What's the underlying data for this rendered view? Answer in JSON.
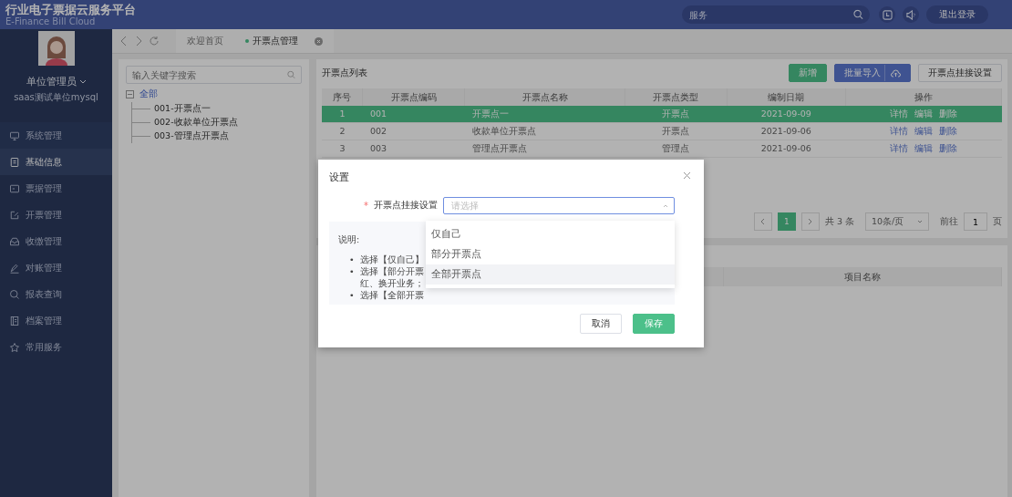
{
  "header": {
    "title": "行业电子票据云服务平台",
    "subtitle": "E-Finance Bill Cloud",
    "search": {
      "placeholder": "服务"
    },
    "logout": "退出登录"
  },
  "sidebar": {
    "user": "单位管理员",
    "org": "saas测试单位mysql",
    "items": [
      {
        "label": "系统管理",
        "kind": "monitor",
        "selected": false
      },
      {
        "label": "基础信息",
        "kind": "doc",
        "selected": true
      },
      {
        "label": "票据管理",
        "kind": "card",
        "selected": false
      },
      {
        "label": "开票管理",
        "kind": "edit",
        "selected": false
      },
      {
        "label": "收缴管理",
        "kind": "inbox",
        "selected": false
      },
      {
        "label": "对账管理",
        "kind": "pen",
        "selected": false
      },
      {
        "label": "报表查询",
        "kind": "search",
        "selected": false
      },
      {
        "label": "档案管理",
        "kind": "book",
        "selected": false
      },
      {
        "label": "常用服务",
        "kind": "star",
        "selected": false
      }
    ]
  },
  "tabs": [
    {
      "label": "欢迎首页",
      "selected": false
    },
    {
      "label": "开票点管理",
      "selected": true
    }
  ],
  "tree": {
    "search": {
      "placeholder": "输入关键字搜索"
    },
    "nodes": [
      {
        "label": "全部",
        "expanded": true,
        "selected": true,
        "children": [
          {
            "label": "001-开票点一",
            "selected": false
          },
          {
            "label": "002-收款单位开票点",
            "selected": false
          },
          {
            "label": "003-管理点开票点",
            "selected": false
          }
        ]
      }
    ]
  },
  "list": {
    "title": "开票点列表",
    "buttons": [
      {
        "label": "新增",
        "kind": "add"
      },
      {
        "label": "批量导入",
        "kind": "import"
      },
      {
        "label": "开票点挂接设置",
        "kind": "plain"
      }
    ],
    "columns": [
      "序号",
      "开票点编码",
      "开票点名称",
      "开票点类型",
      "编制日期",
      "操作"
    ],
    "rows": [
      {
        "cells": [
          "1",
          "001",
          "开票点一",
          "开票点",
          "2021-09-09"
        ],
        "actions": [
          "详情",
          "编辑",
          "删除"
        ],
        "selected": true
      },
      {
        "cells": [
          "2",
          "002",
          "收款单位开票点",
          "开票点",
          "2021-09-06"
        ],
        "actions": [
          "详情",
          "编辑",
          "删除"
        ],
        "selected": false
      },
      {
        "cells": [
          "3",
          "003",
          "管理点开票点",
          "管理点",
          "2021-09-06"
        ],
        "actions": [
          "详情",
          "编辑",
          "删除"
        ],
        "selected": false
      }
    ],
    "pagination": {
      "pages": [
        {
          "label": "1",
          "selected": true
        }
      ],
      "total": "共 3 条",
      "page_size": "10条/页",
      "goto": "前往",
      "goto_value": "1",
      "page_unit": "页"
    }
  },
  "items_table": {
    "columns": [
      "项目名称"
    ]
  },
  "dialog": {
    "title": "设置",
    "field": {
      "required_mark": "*",
      "label": "开票点挂接设置",
      "placeholder": "请选择"
    },
    "note": {
      "title": "说明:",
      "bullets": [
        {
          "marker": "•",
          "text": "选择【仅自己】"
        },
        {
          "marker": "•",
          "text": "选择【部分开票红、换开业务；"
        },
        {
          "marker": "•",
          "text": "选择【全部开票"
        }
      ]
    },
    "options": [
      {
        "label": "仅自己",
        "highlighted": false
      },
      {
        "label": "部分开票点",
        "highlighted": false
      },
      {
        "label": "全部开票点",
        "highlighted": true
      }
    ],
    "buttons": [
      {
        "label": "取消",
        "kind": "plain"
      },
      {
        "label": "保存",
        "kind": "primary"
      }
    ]
  }
}
